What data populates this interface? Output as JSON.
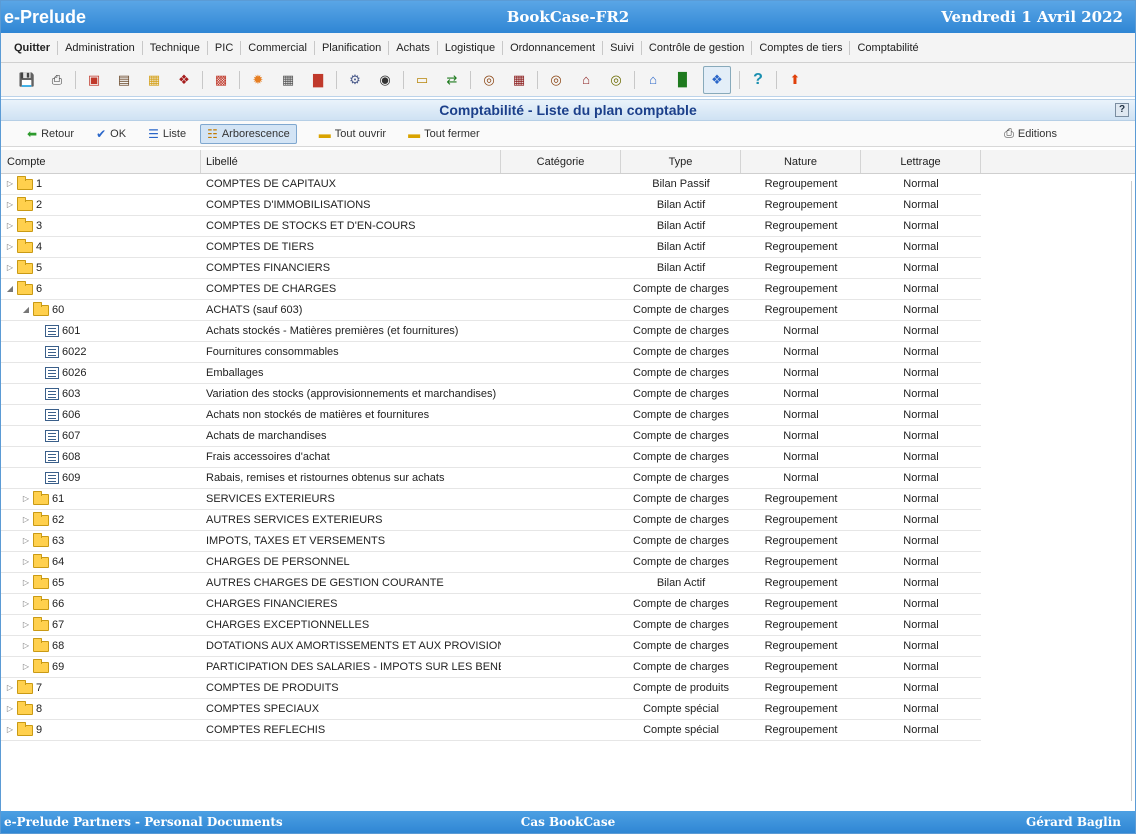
{
  "header": {
    "brand": "e-Prelude",
    "app_title": "BookCase-FR2",
    "date": "Vendredi 1 Avril 2022"
  },
  "menu": [
    "Quitter",
    "Administration",
    "Technique",
    "PIC",
    "Commercial",
    "Planification",
    "Achats",
    "Logistique",
    "Ordonnancement",
    "Suivi",
    "Contrôle de gestion",
    "Comptes de tiers",
    "Comptabilité"
  ],
  "toolbar_icons": [
    "save-icon",
    "print-icon",
    "sep",
    "red-tool-icon",
    "book-icon",
    "folder-a-icon",
    "network-icon",
    "sep",
    "calendar-icon",
    "sep",
    "sun-icon",
    "table-icon",
    "bar-chart-icon",
    "sep",
    "gear-icon",
    "eye-icon",
    "sep",
    "note-icon",
    "transfer-icon",
    "sep",
    "target-icon",
    "ledger-icon",
    "sep",
    "target2-icon",
    "house-icon",
    "target3-icon",
    "sep",
    "house-edit-icon",
    "chart-gallery-icon",
    "puzzle-icon",
    "sep",
    "help-icon",
    "sep",
    "upload-arrow-icon"
  ],
  "page_title": "Comptabilité - Liste du plan comptable",
  "help_label": "?",
  "actions": {
    "back": "Retour",
    "ok": "OK",
    "list": "Liste",
    "tree": "Arborescence",
    "open_all": "Tout ouvrir",
    "close_all": "Tout fermer",
    "editions": "Editions"
  },
  "columns": {
    "compte": "Compte",
    "libelle": "Libellé",
    "categorie": "Catégorie",
    "type": "Type",
    "nature": "Nature",
    "lettrage": "Lettrage"
  },
  "rows": [
    {
      "level": 0,
      "kind": "folder",
      "exp": "closed",
      "compte": "1",
      "libelle": "COMPTES DE CAPITAUX",
      "categorie": "",
      "type": "Bilan Passif",
      "nature": "Regroupement",
      "lettrage": "Normal"
    },
    {
      "level": 0,
      "kind": "folder",
      "exp": "closed",
      "compte": "2",
      "libelle": "COMPTES D'IMMOBILISATIONS",
      "categorie": "",
      "type": "Bilan Actif",
      "nature": "Regroupement",
      "lettrage": "Normal"
    },
    {
      "level": 0,
      "kind": "folder",
      "exp": "closed",
      "compte": "3",
      "libelle": "COMPTES DE STOCKS ET D'EN-COURS",
      "categorie": "",
      "type": "Bilan Actif",
      "nature": "Regroupement",
      "lettrage": "Normal"
    },
    {
      "level": 0,
      "kind": "folder",
      "exp": "closed",
      "compte": "4",
      "libelle": "COMPTES DE TIERS",
      "categorie": "",
      "type": "Bilan Actif",
      "nature": "Regroupement",
      "lettrage": "Normal"
    },
    {
      "level": 0,
      "kind": "folder",
      "exp": "closed",
      "compte": "5",
      "libelle": "COMPTES FINANCIERS",
      "categorie": "",
      "type": "Bilan Actif",
      "nature": "Regroupement",
      "lettrage": "Normal"
    },
    {
      "level": 0,
      "kind": "folder",
      "exp": "open",
      "compte": "6",
      "libelle": "COMPTES DE CHARGES",
      "categorie": "",
      "type": "Compte de charges",
      "nature": "Regroupement",
      "lettrage": "Normal"
    },
    {
      "level": 1,
      "kind": "folder",
      "exp": "open",
      "compte": "60",
      "libelle": "ACHATS (sauf 603)",
      "categorie": "",
      "type": "Compte de charges",
      "nature": "Regroupement",
      "lettrage": "Normal"
    },
    {
      "level": 2,
      "kind": "leaf",
      "exp": "",
      "compte": "601",
      "libelle": "Achats stockés - Matières premières (et fournitures)",
      "categorie": "",
      "type": "Compte de charges",
      "nature": "Normal",
      "lettrage": "Normal"
    },
    {
      "level": 2,
      "kind": "leaf",
      "exp": "",
      "compte": "6022",
      "libelle": "Fournitures consommables",
      "categorie": "",
      "type": "Compte de charges",
      "nature": "Normal",
      "lettrage": "Normal"
    },
    {
      "level": 2,
      "kind": "leaf",
      "exp": "",
      "compte": "6026",
      "libelle": "Emballages",
      "categorie": "",
      "type": "Compte de charges",
      "nature": "Normal",
      "lettrage": "Normal"
    },
    {
      "level": 2,
      "kind": "leaf",
      "exp": "",
      "compte": "603",
      "libelle": "Variation des stocks (approvisionnements et marchandises)",
      "categorie": "",
      "type": "Compte de charges",
      "nature": "Normal",
      "lettrage": "Normal"
    },
    {
      "level": 2,
      "kind": "leaf",
      "exp": "",
      "compte": "606",
      "libelle": "Achats non stockés de matières et fournitures",
      "categorie": "",
      "type": "Compte de charges",
      "nature": "Normal",
      "lettrage": "Normal"
    },
    {
      "level": 2,
      "kind": "leaf",
      "exp": "",
      "compte": "607",
      "libelle": "Achats de marchandises",
      "categorie": "",
      "type": "Compte de charges",
      "nature": "Normal",
      "lettrage": "Normal"
    },
    {
      "level": 2,
      "kind": "leaf",
      "exp": "",
      "compte": "608",
      "libelle": "Frais accessoires d'achat",
      "categorie": "",
      "type": "Compte de charges",
      "nature": "Normal",
      "lettrage": "Normal"
    },
    {
      "level": 2,
      "kind": "leaf",
      "exp": "",
      "compte": "609",
      "libelle": "Rabais, remises et ristournes obtenus sur achats",
      "categorie": "",
      "type": "Compte de charges",
      "nature": "Normal",
      "lettrage": "Normal"
    },
    {
      "level": 1,
      "kind": "folder",
      "exp": "closed",
      "compte": "61",
      "libelle": "SERVICES EXTERIEURS",
      "categorie": "",
      "type": "Compte de charges",
      "nature": "Regroupement",
      "lettrage": "Normal"
    },
    {
      "level": 1,
      "kind": "folder",
      "exp": "closed",
      "compte": "62",
      "libelle": "AUTRES SERVICES EXTERIEURS",
      "categorie": "",
      "type": "Compte de charges",
      "nature": "Regroupement",
      "lettrage": "Normal"
    },
    {
      "level": 1,
      "kind": "folder",
      "exp": "closed",
      "compte": "63",
      "libelle": "IMPOTS, TAXES ET VERSEMENTS",
      "categorie": "",
      "type": "Compte de charges",
      "nature": "Regroupement",
      "lettrage": "Normal"
    },
    {
      "level": 1,
      "kind": "folder",
      "exp": "closed",
      "compte": "64",
      "libelle": "CHARGES DE PERSONNEL",
      "categorie": "",
      "type": "Compte de charges",
      "nature": "Regroupement",
      "lettrage": "Normal"
    },
    {
      "level": 1,
      "kind": "folder",
      "exp": "closed",
      "compte": "65",
      "libelle": "AUTRES CHARGES DE GESTION COURANTE",
      "categorie": "",
      "type": "Bilan Actif",
      "nature": "Regroupement",
      "lettrage": "Normal"
    },
    {
      "level": 1,
      "kind": "folder",
      "exp": "closed",
      "compte": "66",
      "libelle": "CHARGES FINANCIERES",
      "categorie": "",
      "type": "Compte de charges",
      "nature": "Regroupement",
      "lettrage": "Normal"
    },
    {
      "level": 1,
      "kind": "folder",
      "exp": "closed",
      "compte": "67",
      "libelle": "CHARGES EXCEPTIONNELLES",
      "categorie": "",
      "type": "Compte de charges",
      "nature": "Regroupement",
      "lettrage": "Normal"
    },
    {
      "level": 1,
      "kind": "folder",
      "exp": "closed",
      "compte": "68",
      "libelle": "DOTATIONS AUX AMORTISSEMENTS ET AUX PROVISION",
      "categorie": "",
      "type": "Compte de charges",
      "nature": "Regroupement",
      "lettrage": "Normal"
    },
    {
      "level": 1,
      "kind": "folder",
      "exp": "closed",
      "compte": "69",
      "libelle": "PARTICIPATION DES SALARIES - IMPOTS SUR LES BENEI",
      "categorie": "",
      "type": "Compte de charges",
      "nature": "Regroupement",
      "lettrage": "Normal"
    },
    {
      "level": 0,
      "kind": "folder",
      "exp": "closed",
      "compte": "7",
      "libelle": "COMPTES DE PRODUITS",
      "categorie": "",
      "type": "Compte de produits",
      "nature": "Regroupement",
      "lettrage": "Normal"
    },
    {
      "level": 0,
      "kind": "folder",
      "exp": "closed",
      "compte": "8",
      "libelle": "COMPTES SPECIAUX",
      "categorie": "",
      "type": "Compte spécial",
      "nature": "Regroupement",
      "lettrage": "Normal"
    },
    {
      "level": 0,
      "kind": "folder",
      "exp": "closed",
      "compte": "9",
      "libelle": "COMPTES REFLECHIS",
      "categorie": "",
      "type": "Compte spécial",
      "nature": "Regroupement",
      "lettrage": "Normal"
    }
  ],
  "footer": {
    "left": "e-Prelude Partners - Personal Documents",
    "center": "Cas BookCase",
    "right": "Gérard Baglin"
  },
  "colors": {
    "topbar": "#2f86d4",
    "title_text": "#1b3f8a",
    "folder": "#ffd04d"
  }
}
